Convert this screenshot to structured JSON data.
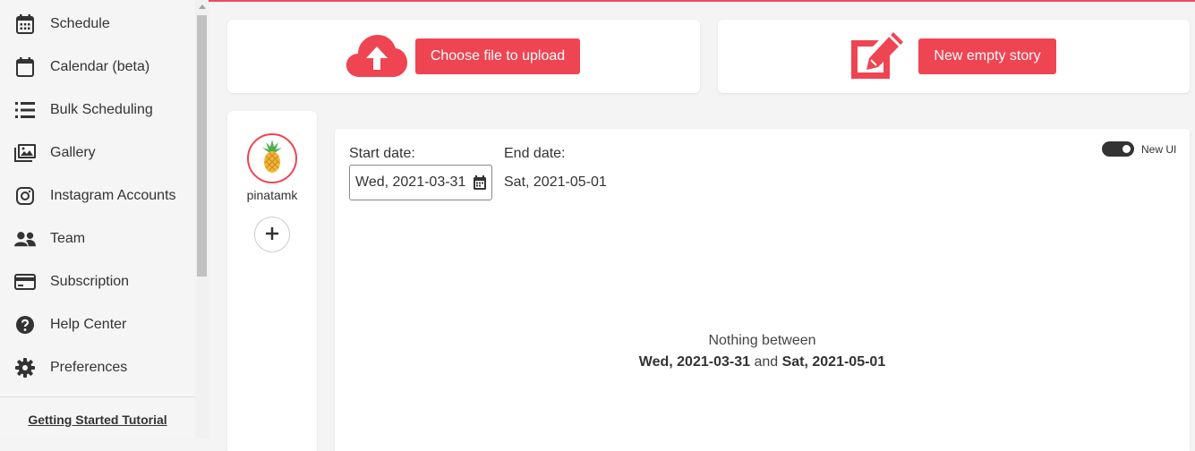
{
  "sidebar": {
    "items": [
      {
        "label": "Schedule",
        "icon": "calendar-grid-icon"
      },
      {
        "label": "Calendar (beta)",
        "icon": "calendar-icon"
      },
      {
        "label": "Bulk Scheduling",
        "icon": "list-icon"
      },
      {
        "label": "Gallery",
        "icon": "gallery-icon"
      },
      {
        "label": "Instagram Accounts",
        "icon": "instagram-icon"
      },
      {
        "label": "Team",
        "icon": "team-icon"
      },
      {
        "label": "Subscription",
        "icon": "credit-card-icon"
      },
      {
        "label": "Help Center",
        "icon": "help-icon"
      },
      {
        "label": "Preferences",
        "icon": "gear-icon"
      }
    ],
    "tutorial_link": "Getting Started Tutorial"
  },
  "actions": {
    "upload_label": "Choose file to upload",
    "new_story_label": "New empty story"
  },
  "accounts": {
    "items": [
      {
        "name": "pinatamk"
      }
    ]
  },
  "filters": {
    "start_label": "Start date:",
    "start_value": "Wed, 2021-03-31",
    "end_label": "End date:",
    "end_value": "Sat, 2021-05-01",
    "new_ui_label": "New UI",
    "new_ui_enabled": true
  },
  "empty_state": {
    "line1": "Nothing between",
    "start": "Wed, 2021-03-31",
    "joiner": "and",
    "end": "Sat, 2021-05-01"
  },
  "colors": {
    "accent": "#ef4452",
    "sidebar_bg": "#f5f5f5",
    "page_bg": "#f4f4f5"
  }
}
